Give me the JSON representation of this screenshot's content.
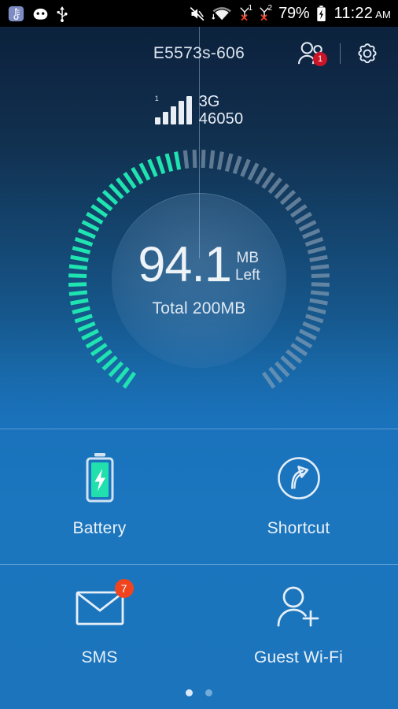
{
  "status_bar": {
    "icons_left": [
      "thermometer-icon",
      "android-head-icon",
      "usb-icon"
    ],
    "icons_right": [
      "mute-icon",
      "wifi-data-icon",
      "sim1-no-signal-icon",
      "sim2-no-signal-icon"
    ],
    "sim1_label": "1",
    "sim2_label": "2",
    "sim_x": "✕",
    "battery_percent": "79%",
    "time": "11:22",
    "ampm": "AM"
  },
  "header": {
    "title": "E5573s-606",
    "users_badge": "1",
    "users_icon": "users-icon",
    "settings_icon": "gear-icon"
  },
  "network": {
    "bars_label": "1",
    "signal_bars": 5,
    "active_bars": 5,
    "type": "3G",
    "operator_code": "46050"
  },
  "gauge": {
    "value": "94.1",
    "unit": "MB",
    "state": "Left",
    "total": "Total 200MB",
    "total_value": 200,
    "remaining_value": 94.1,
    "used_value": 105.9,
    "progress_percent": 47,
    "active_color": "#1fe3b0",
    "inactive_color": "#8fa4b8",
    "tick_count": 72
  },
  "tiles": [
    {
      "label": "Battery",
      "icon": "battery-charging-icon",
      "badge": null
    },
    {
      "label": "Shortcut",
      "icon": "shortcut-arrow-icon",
      "badge": null
    },
    {
      "label": "SMS",
      "icon": "envelope-icon",
      "badge": "7"
    },
    {
      "label": "Guest Wi-Fi",
      "icon": "add-person-icon",
      "badge": null
    }
  ],
  "pagination": {
    "count": 2,
    "active_index": 0
  }
}
